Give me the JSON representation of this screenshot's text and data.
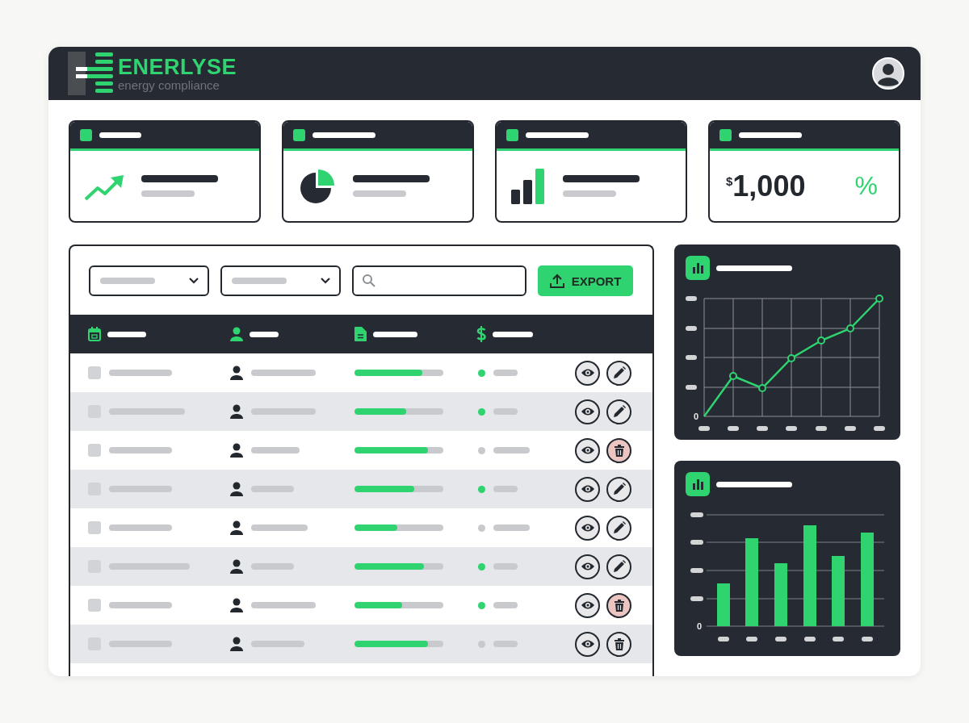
{
  "header": {
    "brand": "ENERLYSE",
    "tagline": "energy compliance"
  },
  "stat_cards": [
    {
      "kind": "trend"
    },
    {
      "kind": "pie"
    },
    {
      "kind": "bars"
    },
    {
      "kind": "value",
      "currency": "$",
      "value": "1,000",
      "unit": "%"
    }
  ],
  "toolbar": {
    "export_button": "EXPORT"
  },
  "table": {
    "rows": [
      {
        "checked": false,
        "level": 0.76,
        "color": "#2fd36f",
        "kind": "edit",
        "danger": false
      },
      {
        "checked": false,
        "level": 0.58,
        "color": "#2fd36f",
        "kind": "edit",
        "danger": false
      },
      {
        "checked": false,
        "level": 0.83,
        "color": "#c8c9cc",
        "kind": "delete",
        "danger": true
      },
      {
        "checked": false,
        "level": 0.67,
        "color": "#2fd36f",
        "kind": "edit",
        "danger": false
      },
      {
        "checked": false,
        "level": 0.48,
        "color": "#c8c9cc",
        "kind": "edit",
        "danger": false
      },
      {
        "checked": false,
        "level": 0.78,
        "color": "#2fd36f",
        "kind": "edit",
        "danger": false
      },
      {
        "checked": false,
        "level": 0.54,
        "color": "#2fd36f",
        "kind": "delete",
        "danger": true
      },
      {
        "checked": false,
        "level": 0.83,
        "color": "#c8c9cc",
        "kind": "delete",
        "danger": false
      }
    ]
  },
  "charts": [
    {
      "kind": "line",
      "axis_zero": "0"
    },
    {
      "kind": "bar",
      "axis_zero": "0"
    }
  ]
}
